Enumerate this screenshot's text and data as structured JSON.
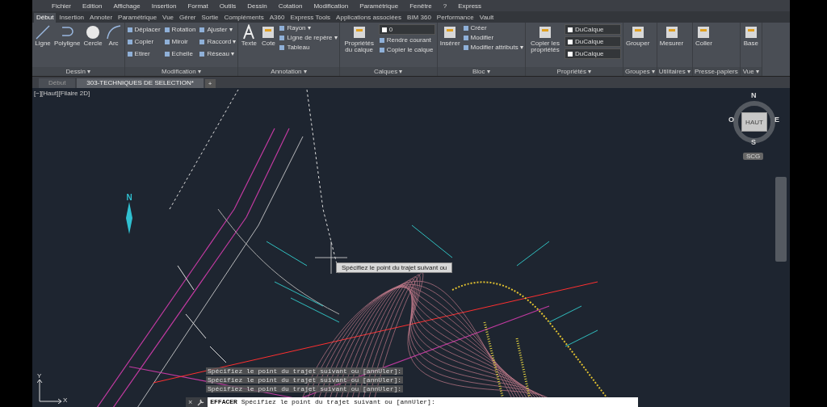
{
  "menu": [
    "Fichier",
    "Edition",
    "Affichage",
    "Insertion",
    "Format",
    "Outils",
    "Dessin",
    "Cotation",
    "Modification",
    "Paramétrique",
    "Fenêtre",
    "?",
    "Express"
  ],
  "ribbon_tabs": [
    {
      "label": "Début",
      "selected": true
    },
    {
      "label": "Insertion",
      "selected": false
    },
    {
      "label": "Annoter",
      "selected": false
    },
    {
      "label": "Paramétrique",
      "selected": false
    },
    {
      "label": "Vue",
      "selected": false
    },
    {
      "label": "Gérer",
      "selected": false
    },
    {
      "label": "Sortie",
      "selected": false
    },
    {
      "label": "Compléments",
      "selected": false
    },
    {
      "label": "A360",
      "selected": false
    },
    {
      "label": "Express Tools",
      "selected": false
    },
    {
      "label": "Applications associées",
      "selected": false
    },
    {
      "label": "BIM 360",
      "selected": false
    },
    {
      "label": "Performance",
      "selected": false
    },
    {
      "label": "Vault",
      "selected": false
    }
  ],
  "panels": [
    {
      "title": "Dessin ▾",
      "large": [
        "Ligne",
        "Polyligne",
        "Cercle",
        "Arc"
      ]
    },
    {
      "title": "Modification ▾",
      "small": [
        "Déplacer",
        "Rotation",
        "Ajuster ▾",
        "Copier",
        "Miroir",
        "Raccord ▾",
        "Etirer",
        "Echelle",
        "Réseau ▾"
      ]
    },
    {
      "title": "Annotation ▾",
      "large": [
        "Texte",
        "Cote"
      ],
      "small": [
        "Rayon ▾",
        "Ligne de repère ▾",
        "Tableau"
      ]
    },
    {
      "title": "Calques ▾",
      "large": [
        "Propriétés du calque"
      ],
      "small": [
        "Rendre courant",
        "Copier le calque"
      ],
      "dropdowns": [
        "0"
      ]
    },
    {
      "title": "Bloc ▾",
      "large": [
        "Insérer"
      ],
      "small": [
        "Créer",
        "Modifier",
        "Modifier attributs ▾"
      ]
    },
    {
      "title": "Propriétés ▾",
      "large": [
        "Copier les propriétés"
      ],
      "dropdowns": [
        "DuCalque",
        "DuCalque",
        "DuCalque"
      ]
    },
    {
      "title": "Groupes ▾",
      "large": [
        "Grouper"
      ]
    },
    {
      "title": "Utilitaires ▾",
      "large": [
        "Mesurer"
      ]
    },
    {
      "title": "Presse-papiers",
      "large": [
        "Coller"
      ]
    },
    {
      "title": "Vue ▾",
      "large": [
        "Base"
      ]
    }
  ],
  "doc_tabs": [
    {
      "label": "Début",
      "selected": false
    },
    {
      "label": "303-TECHNIQUES DE SELECTION*",
      "selected": true
    }
  ],
  "new_tab": "+",
  "viewport_label": "[−][Haut][Filaire 2D]",
  "viewcube": {
    "face": "HAUT",
    "north": "N",
    "south": "S",
    "east": "E",
    "west": "O",
    "ucs": "SCG"
  },
  "north_arrow": "N",
  "axes": {
    "x": "X",
    "y": "Y"
  },
  "tooltip": "Spécifiez le point du trajet suivant ou",
  "command_history": [
    "Spécifiez le point du trajet suivant ou [annUler]:",
    "Spécifiez le point du trajet suivant ou [annUler]:",
    "Spécifiez le point du trajet suivant ou [annUler]:"
  ],
  "command_close": "×",
  "command_line": "**EFFACER** Spécifiez le point du trajet suivant ou [annUler]:"
}
